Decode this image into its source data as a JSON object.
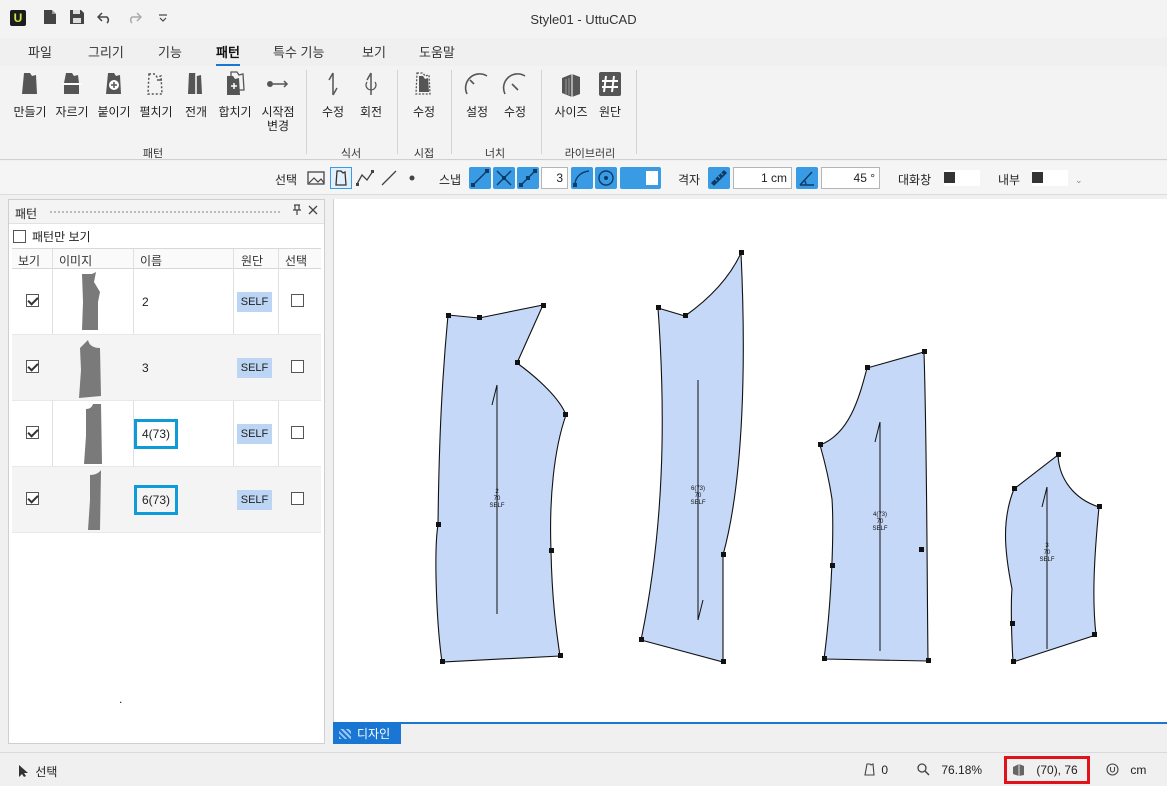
{
  "window": {
    "title": "Style01 - UttuCAD",
    "logo": "U"
  },
  "menu": {
    "tabs": [
      {
        "label": "파일"
      },
      {
        "label": "그리기"
      },
      {
        "label": "기능"
      },
      {
        "label": "패턴"
      },
      {
        "label": "특수 기능"
      },
      {
        "label": "보기"
      },
      {
        "label": "도움말"
      }
    ],
    "active": "패턴"
  },
  "ribbon": {
    "buttons": [
      {
        "label": "만들기"
      },
      {
        "label": "자르기"
      },
      {
        "label": "붙이기"
      },
      {
        "label": "펼치기"
      },
      {
        "label": "전개"
      },
      {
        "label": "합치기"
      },
      {
        "label": "시작점\n변경"
      },
      {
        "label": "수정"
      },
      {
        "label": "회전"
      },
      {
        "label": "수정"
      },
      {
        "label": "설정"
      },
      {
        "label": "수정"
      },
      {
        "label": "사이즈"
      },
      {
        "label": "원단"
      }
    ],
    "groups": [
      {
        "label": "패턴"
      },
      {
        "label": "식서"
      },
      {
        "label": "시접"
      },
      {
        "label": "너치"
      },
      {
        "label": "라이브러리"
      }
    ]
  },
  "toolbar": {
    "select_label": "선택",
    "snap_label": "스냅",
    "snap_value": "3",
    "grid_label": "격자",
    "grid_value": "1 cm",
    "angle_value": "45 °",
    "dialog_label": "대화창",
    "inner_label": "내부"
  },
  "panel": {
    "title": "패턴",
    "show_only_patterns": "패턴만 보기",
    "columns": {
      "view": "보기",
      "image": "이미지",
      "name": "이름",
      "fabric": "원단",
      "select": "선택"
    },
    "rows": [
      {
        "name": "2",
        "fabric": "SELF",
        "visible": true,
        "selected": false,
        "highlight": false
      },
      {
        "name": "3",
        "fabric": "SELF",
        "visible": true,
        "selected": false,
        "highlight": false
      },
      {
        "name": "4(73)",
        "fabric": "SELF",
        "visible": true,
        "selected": false,
        "highlight": true
      },
      {
        "name": "6(73)",
        "fabric": "SELF",
        "visible": true,
        "selected": false,
        "highlight": true
      }
    ],
    "stray_mark": "."
  },
  "canvas": {
    "pieces": [
      {
        "labels": [
          "2",
          "70",
          "SELF"
        ]
      },
      {
        "labels": [
          "6(73)",
          "70",
          "SELF"
        ]
      },
      {
        "labels": [
          "4(73)",
          "70",
          "SELF"
        ]
      },
      {
        "labels": [
          "3",
          "70",
          "SELF"
        ]
      }
    ]
  },
  "design_tab": "디자인",
  "status": {
    "mode": "선택",
    "piece_count": "0",
    "zoom": "76.18%",
    "coords": "(70), 76",
    "unit": "cm"
  },
  "colors": {
    "accent": "#1976d2",
    "piece_fill": "#c5d8f7",
    "highlight_box": "#0f9bd8",
    "coord_box": "#e0131b"
  }
}
